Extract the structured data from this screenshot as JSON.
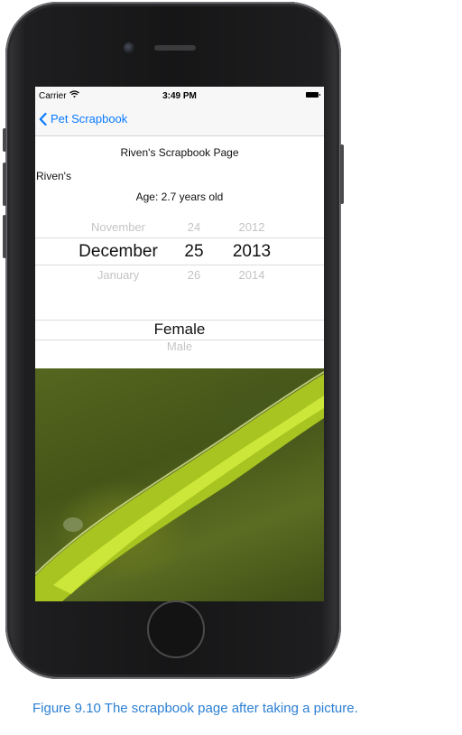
{
  "status_bar": {
    "carrier": "Carrier",
    "time": "3:49 PM"
  },
  "nav": {
    "back_label": "Pet Scrapbook"
  },
  "page": {
    "title": "Riven's Scrapbook Page",
    "name_value": "Riven's",
    "age_text": "Age: 2.7 years old"
  },
  "date_picker": {
    "months": [
      "November",
      "December",
      "January"
    ],
    "days": [
      "24",
      "25",
      "26"
    ],
    "years": [
      "2012",
      "2013",
      "2014"
    ]
  },
  "gender_picker": {
    "options": [
      "Female",
      "Male"
    ]
  },
  "caption": "Figure 9.10 The scrapbook page after taking a picture.",
  "colors": {
    "tint": "#0a7aff",
    "caption": "#2b7fd4"
  }
}
